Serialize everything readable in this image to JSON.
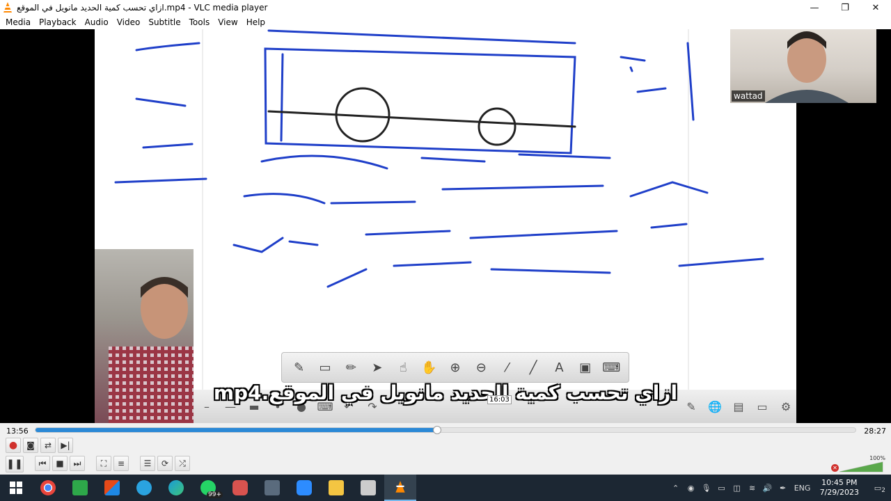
{
  "window": {
    "title": "ازاي تحسب كمية الحديد مانويل في الموقع.mp4 - VLC media player",
    "controls": {
      "minimize": "—",
      "restore": "❐",
      "close": "✕"
    }
  },
  "menu": [
    "Media",
    "Playback",
    "Audio",
    "Video",
    "Subtitle",
    "Tools",
    "View",
    "Help"
  ],
  "video": {
    "subtitle": "ازاي تحسب كمية الحديد مانويل في الموقع.mp4",
    "webcam_label": "wattad",
    "overlay_time": "16:03"
  },
  "whiteboard_toolbar": [
    "pen-icon",
    "eraser-icon",
    "highlighter-icon",
    "pointer-icon",
    "hand-pointer-icon",
    "hand-icon",
    "zoom-in-icon",
    "zoom-out-icon",
    "eyedropper-icon",
    "line-icon",
    "text-icon",
    "screen-icon",
    "keyboard-icon"
  ],
  "playback": {
    "elapsed": "13:56",
    "total": "28:27",
    "progress": 0.49,
    "volume_pct": "100%",
    "volume_level": 1.0,
    "muted": true
  },
  "taskbar": {
    "apps": [
      {
        "name": "start",
        "color": "#ffffff"
      },
      {
        "name": "chrome",
        "color": "#e8453c"
      },
      {
        "name": "camtasia",
        "color": "#2ea84a"
      },
      {
        "name": "office",
        "color": "#e64a19"
      },
      {
        "name": "telegram",
        "color": "#2aa3e0"
      },
      {
        "name": "edge",
        "color": "#1b9bd7"
      },
      {
        "name": "whatsapp",
        "color": "#25d366",
        "badge": "99+"
      },
      {
        "name": "paint",
        "color": "#d9534f"
      },
      {
        "name": "calculator",
        "color": "#5a6b7d"
      },
      {
        "name": "zoom",
        "color": "#2d8cff"
      },
      {
        "name": "file-explorer",
        "color": "#f4c542"
      },
      {
        "name": "whiteboard",
        "color": "#cccccc"
      },
      {
        "name": "vlc",
        "color": "#ff8800"
      }
    ],
    "language": "ENG",
    "time": "10:45 PM",
    "date": "7/29/2023",
    "notifications": "2"
  }
}
